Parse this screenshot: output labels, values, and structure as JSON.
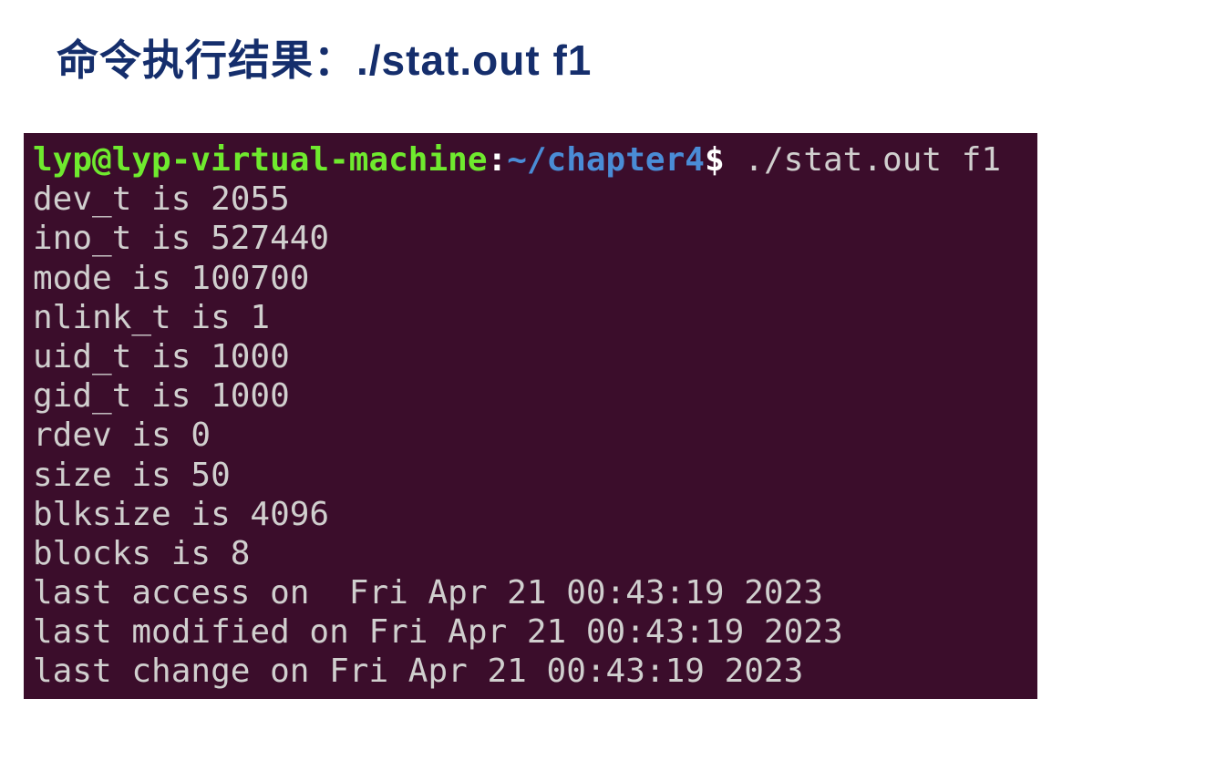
{
  "heading": {
    "label_prefix": "命令执行结果：",
    "command": "./stat.out    f1"
  },
  "terminal": {
    "prompt": {
      "user_host": "lyp@lyp-virtual-machine",
      "colon": ":",
      "path": "~/chapter4",
      "dollar": "$",
      "command": " ./stat.out f1"
    },
    "output": [
      "dev_t is 2055",
      "ino_t is 527440",
      "mode is 100700",
      "nlink_t is 1",
      "uid_t is 1000",
      "gid_t is 1000",
      "rdev is 0",
      "size is 50",
      "blksize is 4096",
      "blocks is 8",
      "last access on  Fri Apr 21 00:43:19 2023",
      "last modified on Fri Apr 21 00:43:19 2023",
      "last change on Fri Apr 21 00:43:19 2023"
    ]
  }
}
